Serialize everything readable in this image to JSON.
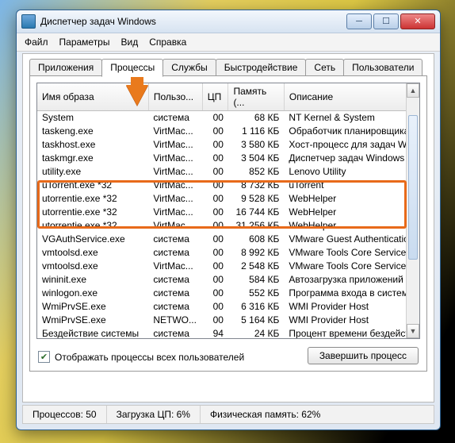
{
  "window": {
    "title": "Диспетчер задач Windows"
  },
  "menu": {
    "file": "Файл",
    "options": "Параметры",
    "view": "Вид",
    "help": "Справка"
  },
  "tabs": {
    "apps": "Приложения",
    "processes": "Процессы",
    "services": "Службы",
    "performance": "Быстродействие",
    "network": "Сеть",
    "users": "Пользователи"
  },
  "columns": {
    "name": "Имя образа",
    "user": "Пользо...",
    "cpu": "ЦП",
    "mem": "Память (...",
    "desc": "Описание"
  },
  "rows": [
    {
      "name": "System",
      "user": "система",
      "cpu": "00",
      "mem": "68 КБ",
      "desc": "NT Kernel & System"
    },
    {
      "name": "taskeng.exe",
      "user": "VirtMac...",
      "cpu": "00",
      "mem": "1 116 КБ",
      "desc": "Обработчик планировщика"
    },
    {
      "name": "taskhost.exe",
      "user": "VirtMac...",
      "cpu": "00",
      "mem": "3 580 КБ",
      "desc": "Хост-процесс для задач W"
    },
    {
      "name": "taskmgr.exe",
      "user": "VirtMac...",
      "cpu": "00",
      "mem": "3 504 КБ",
      "desc": "Диспетчер задач Windows"
    },
    {
      "name": "utility.exe",
      "user": "VirtMac...",
      "cpu": "00",
      "mem": "852 КБ",
      "desc": "Lenovo Utility"
    },
    {
      "name": "uTorrent.exe *32",
      "user": "VirtMac...",
      "cpu": "00",
      "mem": "8 732 КБ",
      "desc": "uTorrent"
    },
    {
      "name": "utorrentie.exe *32",
      "user": "VirtMac...",
      "cpu": "00",
      "mem": "9 528 КБ",
      "desc": "WebHelper"
    },
    {
      "name": "utorrentie.exe *32",
      "user": "VirtMac...",
      "cpu": "00",
      "mem": "16 744 КБ",
      "desc": "WebHelper"
    },
    {
      "name": "utorrentie.exe *32",
      "user": "VirtMac...",
      "cpu": "00",
      "mem": "31 256 КБ",
      "desc": "WebHelper"
    },
    {
      "name": "VGAuthService.exe",
      "user": "система",
      "cpu": "00",
      "mem": "608 КБ",
      "desc": "VMware Guest Authentication"
    },
    {
      "name": "vmtoolsd.exe",
      "user": "система",
      "cpu": "00",
      "mem": "8 992 КБ",
      "desc": "VMware Tools Core Service"
    },
    {
      "name": "vmtoolsd.exe",
      "user": "VirtMac...",
      "cpu": "00",
      "mem": "2 548 КБ",
      "desc": "VMware Tools Core Service"
    },
    {
      "name": "wininit.exe",
      "user": "система",
      "cpu": "00",
      "mem": "584 КБ",
      "desc": "Автозагрузка приложений"
    },
    {
      "name": "winlogon.exe",
      "user": "система",
      "cpu": "00",
      "mem": "552 КБ",
      "desc": "Программа входа в систем"
    },
    {
      "name": "WmiPrvSE.exe",
      "user": "система",
      "cpu": "00",
      "mem": "6 316 КБ",
      "desc": "WMI Provider Host"
    },
    {
      "name": "WmiPrvSE.exe",
      "user": "NETWO...",
      "cpu": "00",
      "mem": "5 164 КБ",
      "desc": "WMI Provider Host"
    },
    {
      "name": "Бездействие системы",
      "user": "система",
      "cpu": "94",
      "mem": "24 КБ",
      "desc": "Процент времени бездейст"
    }
  ],
  "checkbox": {
    "label": "Отображать процессы всех пользователей",
    "checked": true
  },
  "button": {
    "end": "Завершить процесс"
  },
  "status": {
    "procs": "Процессов: 50",
    "cpu": "Загрузка ЦП: 6%",
    "mem": "Физическая память: 62%"
  },
  "highlight_rows": [
    6,
    7,
    8
  ]
}
